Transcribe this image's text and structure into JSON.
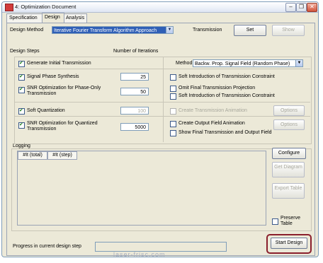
{
  "window": {
    "title": "4: Optimization Document",
    "minimize": "–",
    "restore": "❐",
    "close": "✕"
  },
  "tabs": [
    "Specification",
    "Design",
    "Analysis"
  ],
  "design_method": {
    "label": "Design Method",
    "value": "Iterative Fourier Transform Algorithm Approach",
    "transmission_label": "Transmission",
    "set_button": "Set",
    "show_button": "Show"
  },
  "headers": {
    "design_steps": "Design Steps",
    "number_of_iterations": "Number of Iterations"
  },
  "steps": [
    {
      "label": "Generate Initial Transmission",
      "checked": true,
      "value": ""
    },
    {
      "label": "Signal Phase Synthesis",
      "checked": true,
      "value": "25"
    },
    {
      "label": "SNR Optimization for Phase-Only Transmission",
      "checked": true,
      "value": "50"
    },
    {
      "label": "Soft Quantization",
      "checked": true,
      "value": "100"
    },
    {
      "label": "SNR Optimization for Quantized Transmission",
      "checked": true,
      "value": "5000"
    }
  ],
  "method": {
    "label": "Method",
    "value": "Backw. Prop. Signal Field (Random Phase)"
  },
  "options": [
    {
      "label": "Soft Introduction of Transmission Constraint",
      "checked": false
    },
    {
      "label": "Omit Final Transmission Projection",
      "checked": false
    },
    {
      "label": "Soft Introduction of Transmission Constraint",
      "checked": false
    },
    {
      "label": "Create Transmission Animation",
      "checked": false
    },
    {
      "label": "Create Output Field Animation",
      "checked": false
    },
    {
      "label": "Show Final Transmission and Output Field",
      "checked": false
    }
  ],
  "options_button": "Options",
  "logging": {
    "label": "Logging",
    "columns": [
      "#It (total)",
      "#It (step)"
    ],
    "configure_button": "Configure",
    "get_diagram_button": "Get Diagram",
    "export_table_button": "Export Table",
    "preserve_table_label": "Preserve Table"
  },
  "footer": {
    "progress_label": "Progress in current design step",
    "start_button": "Start Design",
    "watermark": "laser-frisc.com"
  }
}
